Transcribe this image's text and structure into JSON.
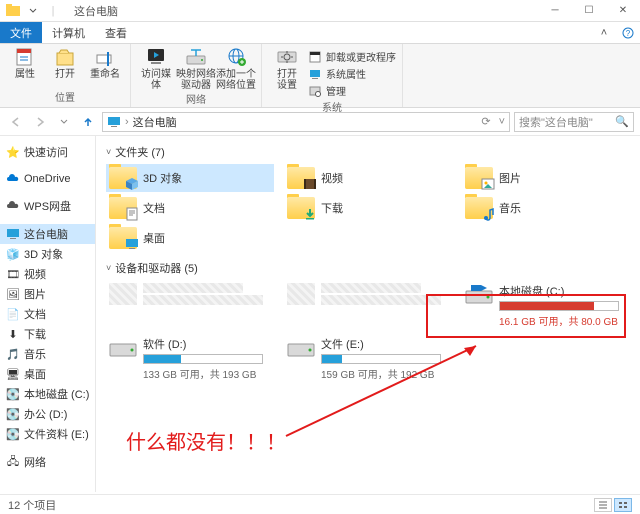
{
  "window": {
    "title": "这台电脑"
  },
  "ribbon_tabs": {
    "file": "文件",
    "computer": "计算机",
    "view": "查看"
  },
  "ribbon": {
    "g1": {
      "prop": "属性",
      "open": "打开",
      "rename": "重命名",
      "label": "位置"
    },
    "g2": {
      "media": "访问媒体",
      "map": "映射网络\n驱动器",
      "addnet": "添加一个\n网络位置",
      "label": "网络"
    },
    "g3": {
      "opensettings": "打开\n设置",
      "uninstall": "卸载或更改程序",
      "sysprops": "系统属性",
      "manage": "管理",
      "label": "系统"
    }
  },
  "addr": {
    "location": "这台电脑",
    "search_placeholder": "搜索\"这台电脑\""
  },
  "tree": {
    "quick": "快速访问",
    "onedrive": "OneDrive",
    "wps": "WPS网盘",
    "thispc": "这台电脑",
    "obj3d": "3D 对象",
    "videos": "视频",
    "pictures": "图片",
    "docs": "文档",
    "downloads": "下载",
    "music": "音乐",
    "desktop": "桌面",
    "cdrive": "本地磁盘 (C:)",
    "office": "办公 (D:)",
    "files": "文件资料 (E:)",
    "network": "网络"
  },
  "folders": {
    "header": "文件夹 (7)",
    "obj3d": "3D 对象",
    "videos": "视频",
    "pictures": "图片",
    "docs": "文档",
    "downloads": "下载",
    "music": "音乐",
    "desktop": "桌面"
  },
  "drives": {
    "header": "设备和驱动器 (5)",
    "c": {
      "name": "本地磁盘 (C:)",
      "sub": "16.1 GB 可用，共 80.0 GB",
      "pct": 80
    },
    "d": {
      "name": "软件 (D:)",
      "sub": "133 GB 可用，共 193 GB",
      "pct": 31
    },
    "e": {
      "name": "文件 (E:)",
      "sub": "159 GB 可用，共 192 GB",
      "pct": 17
    }
  },
  "annotation": "什么都没有！！！",
  "status": {
    "count": "12 个项目"
  }
}
